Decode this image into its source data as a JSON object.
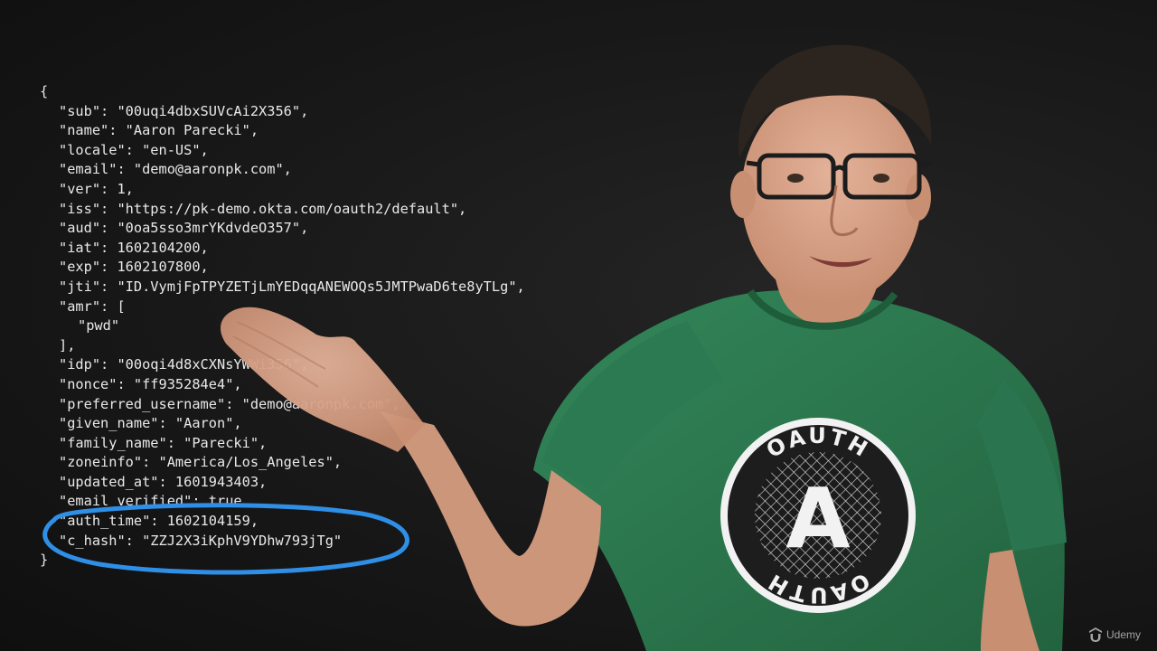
{
  "code": {
    "lines": [
      {
        "indent": 0,
        "text": "{"
      },
      {
        "indent": 1,
        "text": "\"sub\": \"00uqi4dbxSUVcAi2X356\","
      },
      {
        "indent": 1,
        "text": "\"name\": \"Aaron Parecki\","
      },
      {
        "indent": 1,
        "text": "\"locale\": \"en-US\","
      },
      {
        "indent": 1,
        "text": "\"email\": \"demo@aaronpk.com\","
      },
      {
        "indent": 1,
        "text": "\"ver\": 1,"
      },
      {
        "indent": 1,
        "text": "\"iss\": \"https://pk-demo.okta.com/oauth2/default\","
      },
      {
        "indent": 1,
        "text": "\"aud\": \"0oa5sso3mrYKdvdeO357\","
      },
      {
        "indent": 1,
        "text": "\"iat\": 1602104200,"
      },
      {
        "indent": 1,
        "text": "\"exp\": 1602107800,"
      },
      {
        "indent": 1,
        "text": "\"jti\": \"ID.VymjFpTPYZETjLmYEDqqANEWOQs5JMTPwaD6te8yTLg\","
      },
      {
        "indent": 1,
        "text": "\"amr\": ["
      },
      {
        "indent": 2,
        "text": "\"pwd\""
      },
      {
        "indent": 1,
        "text": "],"
      },
      {
        "indent": 1,
        "text": "\"idp\": \"00oqi4d8xCXNsYWWi356\","
      },
      {
        "indent": 1,
        "text": "\"nonce\": \"ff935284e4\","
      },
      {
        "indent": 1,
        "text": "\"preferred_username\": \"demo@aaronpk.com\","
      },
      {
        "indent": 1,
        "text": "\"given_name\": \"Aaron\","
      },
      {
        "indent": 1,
        "text": "\"family_name\": \"Parecki\","
      },
      {
        "indent": 1,
        "text": "\"zoneinfo\": \"America/Los_Angeles\","
      },
      {
        "indent": 1,
        "text": "\"updated_at\": 1601943403,"
      },
      {
        "indent": 1,
        "text": "\"email_verified\": true,"
      },
      {
        "indent": 1,
        "text": "\"auth_time\": 1602104159,"
      },
      {
        "indent": 1,
        "text": "\"c_hash\": \"ZZJ2X3iKphV9YDhw793jTg\""
      },
      {
        "indent": 0,
        "text": "}"
      }
    ]
  },
  "shirt_logo": {
    "top_text": "OAUTH",
    "bottom_text": "OAUTH",
    "letter": "A"
  },
  "watermark": {
    "label": "Udemy"
  },
  "colors": {
    "background": "#141414",
    "code_text": "#e9e9e9",
    "annotation_circle": "#2f8fe6",
    "shirt": "#2e7d4f",
    "skin": "#d9a58a",
    "hair": "#2c241f"
  }
}
